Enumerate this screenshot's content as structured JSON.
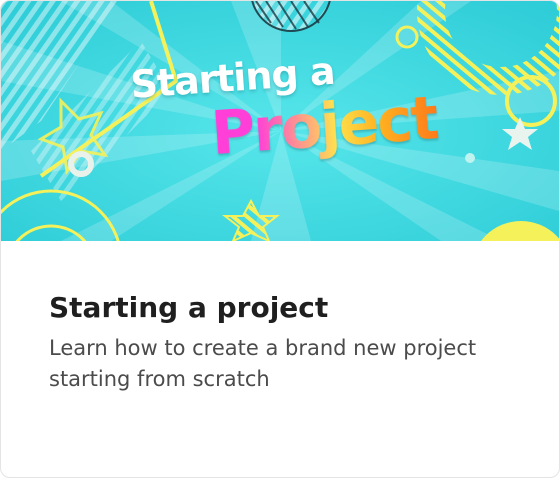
{
  "card": {
    "hero_text_line1": "Starting a",
    "hero_text_line2": "Project",
    "title": "Starting a project",
    "description": "Learn how to create a brand new project starting from scratch"
  },
  "colors": {
    "hero_background": "#3fd6de",
    "accent_yellow": "#f4f15a",
    "title_text": "#1f1f1f",
    "description_text": "#4b4b4b"
  },
  "icons": [
    "star-icon",
    "circle-ring-icon",
    "sunburst-decoration"
  ]
}
